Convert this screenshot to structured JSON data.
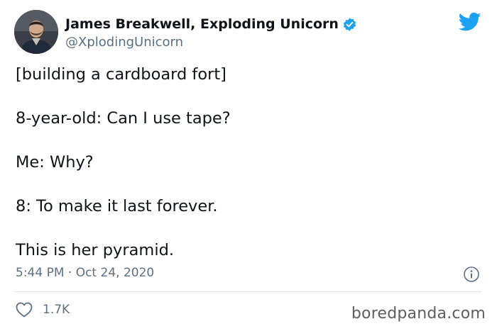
{
  "author": {
    "display_name": "James Breakwell, Exploding Unicorn",
    "handle": "@XplodingUnicorn",
    "verified": true,
    "avatar_icon": "avatar-photo"
  },
  "brand": {
    "icon": "twitter-bird-icon",
    "color": "#1da1f2"
  },
  "tweet": {
    "paragraphs": [
      "[building a cardboard fort]",
      "8-year-old: Can I use tape?",
      "Me: Why?",
      "8: To make it last forever.",
      "This is her pyramid."
    ],
    "timestamp": "5:44 PM · Oct 24, 2020",
    "info_icon": "info-icon"
  },
  "engagement": {
    "like_icon": "heart-icon",
    "like_count": "1.7K"
  },
  "watermark": "boredpanda.com",
  "colors": {
    "text_primary": "#0f1419",
    "text_secondary": "#5b7083",
    "divider": "#e1e8ed",
    "verified_badge": "#1da1f2"
  }
}
